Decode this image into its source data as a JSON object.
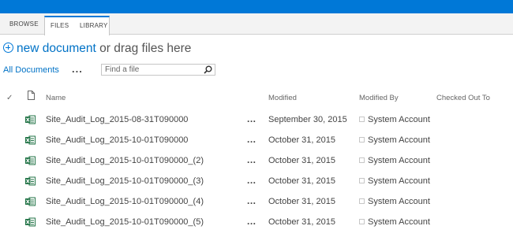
{
  "ribbon": {
    "tabs": [
      {
        "label": "BROWSE"
      },
      {
        "label": "FILES"
      },
      {
        "label": "LIBRARY"
      }
    ]
  },
  "new_document": {
    "link": "new document",
    "rest": " or drag files here"
  },
  "view": {
    "current": "All Documents",
    "more": "...",
    "search_placeholder": "Find a file"
  },
  "table": {
    "columns": [
      "Name",
      "Modified",
      "Modified By",
      "Checked Out To"
    ],
    "rows": [
      {
        "name": "Site_Audit_Log_2015-08-31T090000",
        "modified": "September 30, 2015",
        "modified_by": "System Account"
      },
      {
        "name": "Site_Audit_Log_2015-10-01T090000",
        "modified": "October 31, 2015",
        "modified_by": "System Account"
      },
      {
        "name": "Site_Audit_Log_2015-10-01T090000_(2)",
        "modified": "October 31, 2015",
        "modified_by": "System Account"
      },
      {
        "name": "Site_Audit_Log_2015-10-01T090000_(3)",
        "modified": "October 31, 2015",
        "modified_by": "System Account"
      },
      {
        "name": "Site_Audit_Log_2015-10-01T090000_(4)",
        "modified": "October 31, 2015",
        "modified_by": "System Account"
      },
      {
        "name": "Site_Audit_Log_2015-10-01T090000_(5)",
        "modified": "October 31, 2015",
        "modified_by": "System Account"
      }
    ],
    "row_menu": "..."
  },
  "icons": {
    "select_all": "check-icon",
    "doc_type": "document-icon",
    "file_type": "excel-icon",
    "search": "search-icon"
  },
  "colors": {
    "accent": "#0078d7",
    "link": "#0072c6",
    "excel": "#217346"
  }
}
